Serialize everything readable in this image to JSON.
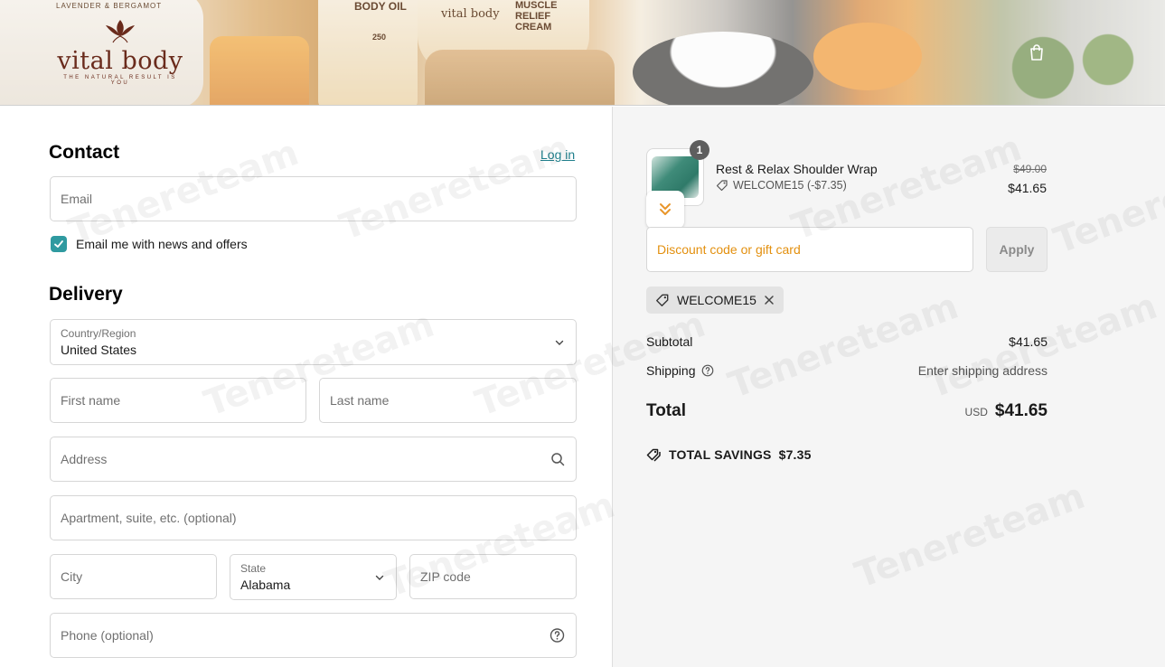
{
  "header": {
    "brand_name": "vital body",
    "brand_tagline": "THE NATURAL RESULT IS YOU",
    "banner_labels": [
      "LAVENDER & BERGAMOT",
      "BODY OIL",
      "vital body",
      "MUSCLE RELIEF CREAM",
      "250"
    ],
    "cart_icon": "shopping-bag-icon"
  },
  "contact": {
    "title": "Contact",
    "login_label": "Log in",
    "email_placeholder": "Email",
    "newsletter_label": "Email me with news and offers",
    "newsletter_checked": true
  },
  "delivery": {
    "title": "Delivery",
    "country_label": "Country/Region",
    "country_value": "United States",
    "first_name_placeholder": "First name",
    "last_name_placeholder": "Last name",
    "address_placeholder": "Address",
    "apartment_placeholder": "Apartment, suite, etc. (optional)",
    "city_placeholder": "City",
    "state_label": "State",
    "state_value": "Alabama",
    "zip_placeholder": "ZIP code",
    "phone_placeholder": "Phone (optional)"
  },
  "summary": {
    "item": {
      "quantity": "1",
      "name": "Rest & Relax Shoulder Wrap",
      "discount": "WELCOME15 (-$7.35)",
      "original_price": "$49.00",
      "price": "$41.65"
    },
    "discount_placeholder": "Discount code or gift card",
    "apply_label": "Apply",
    "applied_code": "WELCOME15",
    "subtotal_label": "Subtotal",
    "subtotal_value": "$41.65",
    "shipping_label": "Shipping",
    "shipping_value": "Enter shipping address",
    "total_label": "Total",
    "currency": "USD",
    "total_value": "$41.65",
    "savings_label": "TOTAL SAVINGS",
    "savings_value": "$7.35"
  },
  "watermark": "Tenereteam",
  "colors": {
    "accent_teal": "#2f9aa0",
    "link": "#1f7f8c",
    "placeholder_orange": "#e3900f",
    "brand_brown": "#6a2b1c"
  }
}
